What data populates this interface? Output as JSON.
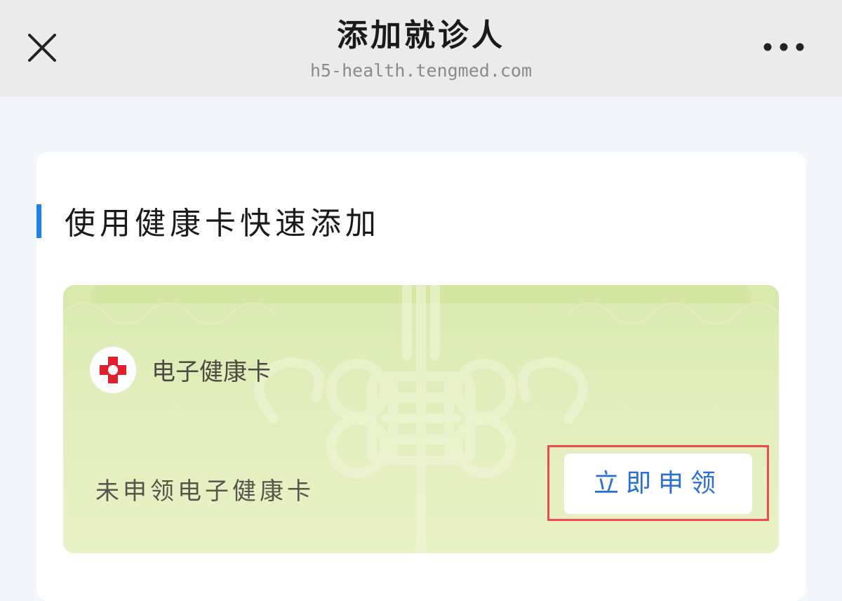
{
  "header": {
    "title": "添加就诊人",
    "url": "h5-health.tengmed.com",
    "close_icon": "close-icon",
    "more_icon": "more-horizontal-icon"
  },
  "section": {
    "title": "使用健康卡快速添加",
    "accent_color": "#1f7ef0"
  },
  "health_card": {
    "name": "电子健康卡",
    "logo_icon": "red-cross-icon",
    "status": "未申领电子健康卡",
    "apply_label": "立即申领",
    "apply_color": "#2a6fd6",
    "highlight_color": "#f04a4a",
    "card_color": "#d9e9ac"
  }
}
